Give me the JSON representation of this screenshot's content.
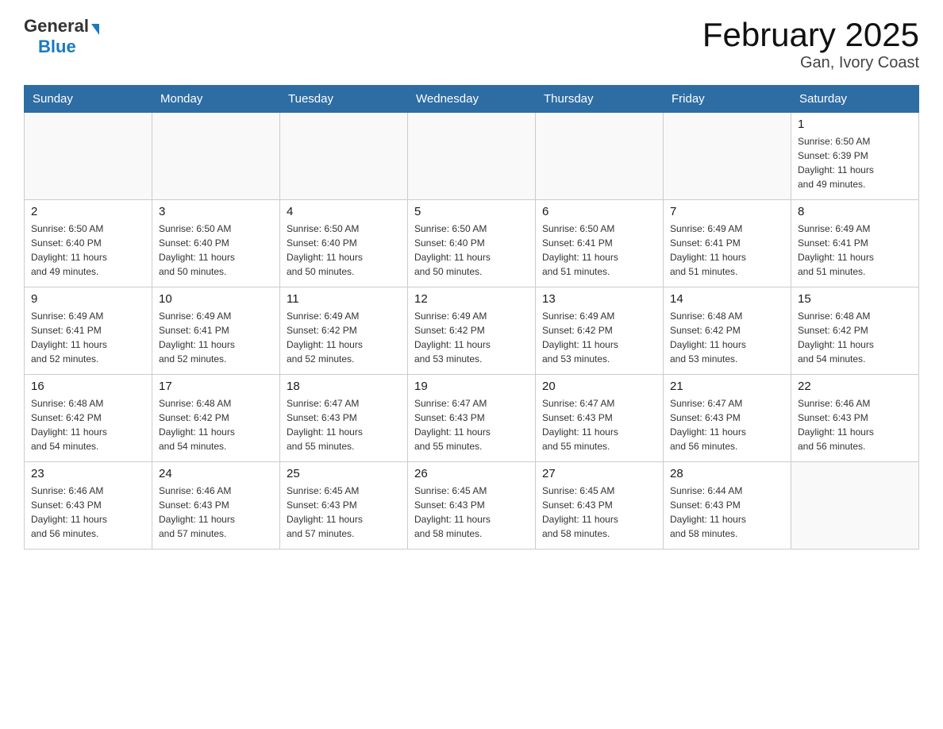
{
  "header": {
    "logo_general": "General",
    "logo_blue": "Blue",
    "title": "February 2025",
    "subtitle": "Gan, Ivory Coast"
  },
  "weekdays": [
    "Sunday",
    "Monday",
    "Tuesday",
    "Wednesday",
    "Thursday",
    "Friday",
    "Saturday"
  ],
  "weeks": [
    [
      {
        "day": "",
        "info": ""
      },
      {
        "day": "",
        "info": ""
      },
      {
        "day": "",
        "info": ""
      },
      {
        "day": "",
        "info": ""
      },
      {
        "day": "",
        "info": ""
      },
      {
        "day": "",
        "info": ""
      },
      {
        "day": "1",
        "info": "Sunrise: 6:50 AM\nSunset: 6:39 PM\nDaylight: 11 hours\nand 49 minutes."
      }
    ],
    [
      {
        "day": "2",
        "info": "Sunrise: 6:50 AM\nSunset: 6:40 PM\nDaylight: 11 hours\nand 49 minutes."
      },
      {
        "day": "3",
        "info": "Sunrise: 6:50 AM\nSunset: 6:40 PM\nDaylight: 11 hours\nand 50 minutes."
      },
      {
        "day": "4",
        "info": "Sunrise: 6:50 AM\nSunset: 6:40 PM\nDaylight: 11 hours\nand 50 minutes."
      },
      {
        "day": "5",
        "info": "Sunrise: 6:50 AM\nSunset: 6:40 PM\nDaylight: 11 hours\nand 50 minutes."
      },
      {
        "day": "6",
        "info": "Sunrise: 6:50 AM\nSunset: 6:41 PM\nDaylight: 11 hours\nand 51 minutes."
      },
      {
        "day": "7",
        "info": "Sunrise: 6:49 AM\nSunset: 6:41 PM\nDaylight: 11 hours\nand 51 minutes."
      },
      {
        "day": "8",
        "info": "Sunrise: 6:49 AM\nSunset: 6:41 PM\nDaylight: 11 hours\nand 51 minutes."
      }
    ],
    [
      {
        "day": "9",
        "info": "Sunrise: 6:49 AM\nSunset: 6:41 PM\nDaylight: 11 hours\nand 52 minutes."
      },
      {
        "day": "10",
        "info": "Sunrise: 6:49 AM\nSunset: 6:41 PM\nDaylight: 11 hours\nand 52 minutes."
      },
      {
        "day": "11",
        "info": "Sunrise: 6:49 AM\nSunset: 6:42 PM\nDaylight: 11 hours\nand 52 minutes."
      },
      {
        "day": "12",
        "info": "Sunrise: 6:49 AM\nSunset: 6:42 PM\nDaylight: 11 hours\nand 53 minutes."
      },
      {
        "day": "13",
        "info": "Sunrise: 6:49 AM\nSunset: 6:42 PM\nDaylight: 11 hours\nand 53 minutes."
      },
      {
        "day": "14",
        "info": "Sunrise: 6:48 AM\nSunset: 6:42 PM\nDaylight: 11 hours\nand 53 minutes."
      },
      {
        "day": "15",
        "info": "Sunrise: 6:48 AM\nSunset: 6:42 PM\nDaylight: 11 hours\nand 54 minutes."
      }
    ],
    [
      {
        "day": "16",
        "info": "Sunrise: 6:48 AM\nSunset: 6:42 PM\nDaylight: 11 hours\nand 54 minutes."
      },
      {
        "day": "17",
        "info": "Sunrise: 6:48 AM\nSunset: 6:42 PM\nDaylight: 11 hours\nand 54 minutes."
      },
      {
        "day": "18",
        "info": "Sunrise: 6:47 AM\nSunset: 6:43 PM\nDaylight: 11 hours\nand 55 minutes."
      },
      {
        "day": "19",
        "info": "Sunrise: 6:47 AM\nSunset: 6:43 PM\nDaylight: 11 hours\nand 55 minutes."
      },
      {
        "day": "20",
        "info": "Sunrise: 6:47 AM\nSunset: 6:43 PM\nDaylight: 11 hours\nand 55 minutes."
      },
      {
        "day": "21",
        "info": "Sunrise: 6:47 AM\nSunset: 6:43 PM\nDaylight: 11 hours\nand 56 minutes."
      },
      {
        "day": "22",
        "info": "Sunrise: 6:46 AM\nSunset: 6:43 PM\nDaylight: 11 hours\nand 56 minutes."
      }
    ],
    [
      {
        "day": "23",
        "info": "Sunrise: 6:46 AM\nSunset: 6:43 PM\nDaylight: 11 hours\nand 56 minutes."
      },
      {
        "day": "24",
        "info": "Sunrise: 6:46 AM\nSunset: 6:43 PM\nDaylight: 11 hours\nand 57 minutes."
      },
      {
        "day": "25",
        "info": "Sunrise: 6:45 AM\nSunset: 6:43 PM\nDaylight: 11 hours\nand 57 minutes."
      },
      {
        "day": "26",
        "info": "Sunrise: 6:45 AM\nSunset: 6:43 PM\nDaylight: 11 hours\nand 58 minutes."
      },
      {
        "day": "27",
        "info": "Sunrise: 6:45 AM\nSunset: 6:43 PM\nDaylight: 11 hours\nand 58 minutes."
      },
      {
        "day": "28",
        "info": "Sunrise: 6:44 AM\nSunset: 6:43 PM\nDaylight: 11 hours\nand 58 minutes."
      },
      {
        "day": "",
        "info": ""
      }
    ]
  ]
}
